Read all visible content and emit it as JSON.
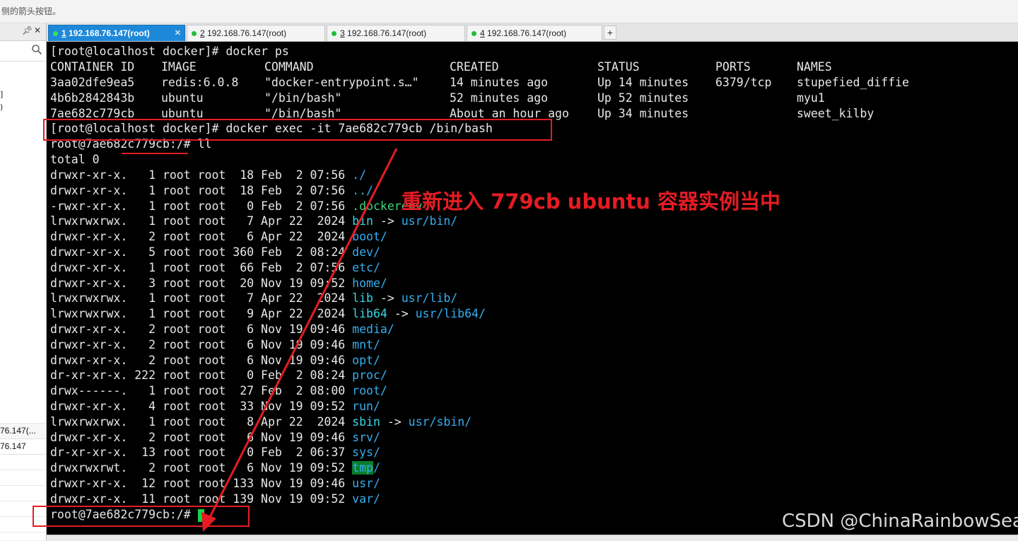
{
  "hint_text": "侧的箭头按钮。",
  "left_panel": {
    "trunc_lines": [
      "]",
      ")"
    ],
    "sessions": [
      "76.147(...",
      "76.147"
    ]
  },
  "tabs": [
    {
      "num": "1",
      "label": " 192.168.76.147(root)",
      "active": true
    },
    {
      "num": "2",
      "label": " 192.168.76.147(root)",
      "active": false
    },
    {
      "num": "3",
      "label": " 192.168.76.147(root)",
      "active": false
    },
    {
      "num": "4",
      "label": " 192.168.76.147(root)",
      "active": false
    }
  ],
  "terminal": {
    "prompt_line": "[root@localhost docker]# docker ps",
    "ps_columns": [
      "CONTAINER ID",
      "IMAGE",
      "COMMAND",
      "CREATED",
      "STATUS",
      "PORTS",
      "NAMES"
    ],
    "ps_rows": [
      [
        "3aa02dfe9ea5",
        "redis:6.0.8",
        "\"docker-entrypoint.s…\"",
        "14 minutes ago",
        "Up 14 minutes",
        "6379/tcp",
        "stupefied_diffie"
      ],
      [
        "4b6b2842843b",
        "ubuntu",
        "\"/bin/bash\"",
        "52 minutes ago",
        "Up 52 minutes",
        "",
        "myu1"
      ],
      [
        "7ae682c779cb",
        "ubuntu",
        "\"/bin/bash\"",
        "About an hour ago",
        "Up 34 minutes",
        "",
        "sweet_kilby"
      ]
    ],
    "exec_line": "[root@localhost docker]# docker exec -it 7ae682c779cb /bin/bash",
    "ll_line": "root@7ae682c779cb:/# ll",
    "total_line": "total 0",
    "listing": [
      {
        "meta": "drwxr-xr-x.   1 root root  18 Feb  2 07:56 ",
        "name": "./",
        "kind": "dir",
        "target": ""
      },
      {
        "meta": "drwxr-xr-x.   1 root root  18 Feb  2 07:56 ",
        "name": "../",
        "kind": "dir",
        "target": ""
      },
      {
        "meta": "-rwxr-xr-x.   1 root root   0 Feb  2 07:56 ",
        "name": ".dockerenv",
        "kind": "dotfile",
        "target": ""
      },
      {
        "meta": "lrwxrwxrwx.   1 root root   7 Apr 22  2024 ",
        "name": "bin",
        "kind": "lnk",
        "target": "usr/bin/"
      },
      {
        "meta": "drwxr-xr-x.   2 root root   6 Apr 22  2024 ",
        "name": "boot/",
        "kind": "dir",
        "target": ""
      },
      {
        "meta": "drwxr-xr-x.   5 root root 360 Feb  2 08:24 ",
        "name": "dev/",
        "kind": "dir",
        "target": ""
      },
      {
        "meta": "drwxr-xr-x.   1 root root  66 Feb  2 07:56 ",
        "name": "etc/",
        "kind": "dir",
        "target": ""
      },
      {
        "meta": "drwxr-xr-x.   3 root root  20 Nov 19 09:52 ",
        "name": "home/",
        "kind": "dir",
        "target": ""
      },
      {
        "meta": "lrwxrwxrwx.   1 root root   7 Apr 22  2024 ",
        "name": "lib",
        "kind": "lnk",
        "target": "usr/lib/"
      },
      {
        "meta": "lrwxrwxrwx.   1 root root   9 Apr 22  2024 ",
        "name": "lib64",
        "kind": "lnk",
        "target": "usr/lib64/"
      },
      {
        "meta": "drwxr-xr-x.   2 root root   6 Nov 19 09:46 ",
        "name": "media/",
        "kind": "dir",
        "target": ""
      },
      {
        "meta": "drwxr-xr-x.   2 root root   6 Nov 19 09:46 ",
        "name": "mnt/",
        "kind": "dir",
        "target": ""
      },
      {
        "meta": "drwxr-xr-x.   2 root root   6 Nov 19 09:46 ",
        "name": "opt/",
        "kind": "dir",
        "target": ""
      },
      {
        "meta": "dr-xr-xr-x. 222 root root   0 Feb  2 08:24 ",
        "name": "proc/",
        "kind": "dir",
        "target": ""
      },
      {
        "meta": "drwx------.   1 root root  27 Feb  2 08:00 ",
        "name": "root/",
        "kind": "dir",
        "target": ""
      },
      {
        "meta": "drwxr-xr-x.   4 root root  33 Nov 19 09:52 ",
        "name": "run/",
        "kind": "dir",
        "target": ""
      },
      {
        "meta": "lrwxrwxrwx.   1 root root   8 Apr 22  2024 ",
        "name": "sbin",
        "kind": "lnk",
        "target": "usr/sbin/"
      },
      {
        "meta": "drwxr-xr-x.   2 root root   6 Nov 19 09:46 ",
        "name": "srv/",
        "kind": "dir",
        "target": ""
      },
      {
        "meta": "dr-xr-xr-x.  13 root root   0 Feb  2 06:37 ",
        "name": "sys/",
        "kind": "dir",
        "target": ""
      },
      {
        "meta": "drwxrwxrwt.   2 root root   6 Nov 19 09:52 ",
        "name": "tmp",
        "kind": "tmp",
        "target": ""
      },
      {
        "meta": "drwxr-xr-x.  12 root root 133 Nov 19 09:46 ",
        "name": "usr/",
        "kind": "dir",
        "target": ""
      },
      {
        "meta": "drwxr-xr-x.  11 root root 139 Nov 19 09:52 ",
        "name": "var/",
        "kind": "dir",
        "target": ""
      }
    ],
    "final_prompt": "root@7ae682c779cb:/# "
  },
  "annotation_text": "重新进入 779cb ubuntu 容器实例当中",
  "watermark_text": "CSDN @ChinaRainbowSea",
  "colors": {
    "annotation_red": "#e51c23",
    "dir_blue": "#36aef0",
    "link_cyan": "#36d8e6",
    "cursor_green": "#17d24d",
    "active_tab_blue": "#1e88d8"
  }
}
